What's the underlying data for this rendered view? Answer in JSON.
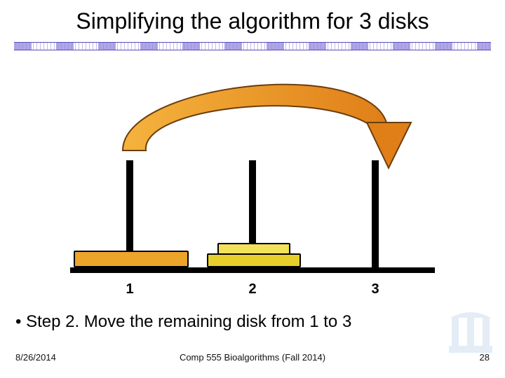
{
  "title": "Simplifying the algorithm for 3 disks",
  "peg_labels": {
    "p1": "1",
    "p2": "2",
    "p3": "3"
  },
  "bullet_text": "• Step 2.  Move the remaining disk from 1 to 3",
  "footer": {
    "date": "8/26/2014",
    "course": "Comp 555 Bioalgorithms (Fall 2014)",
    "page": "28"
  }
}
